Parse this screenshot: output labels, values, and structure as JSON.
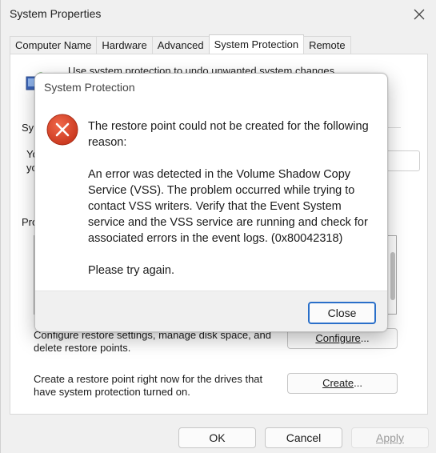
{
  "window": {
    "title": "System Properties"
  },
  "tabs": [
    {
      "label": "Computer Name"
    },
    {
      "label": "Hardware"
    },
    {
      "label": "Advanced"
    },
    {
      "label": "System Protection"
    },
    {
      "label": "Remote"
    }
  ],
  "panel": {
    "intro_partial": "Use system protection to undo unwanted system changes.",
    "sy_label": "Sy",
    "yo_line1": "Yo",
    "yo_line2": "yo",
    "pro_label": "Pro",
    "configure_text_line1": "Configure restore settings, manage disk space, and",
    "configure_text_line2": "delete restore points.",
    "configure_button_pre": "",
    "configure_button_u": "Configure",
    "configure_button_post": "...",
    "create_text_line1": "Create a restore point right now for the drives that",
    "create_text_line2": "have system protection turned on.",
    "create_button_pre": "",
    "create_button_u": "Create",
    "create_button_post": "..."
  },
  "buttons": {
    "ok": "OK",
    "cancel": "Cancel",
    "apply": "Apply"
  },
  "dialog": {
    "title": "System Protection",
    "icon": "error-icon",
    "message1": "The restore point could not be created for the following reason:",
    "message2": "An error was detected in the Volume Shadow Copy Service (VSS). The problem occurred while trying to contact VSS writers. Verify that the Event System service and the VSS service are running and check for associated errors in the event logs. (0x80042318)",
    "message3": "Please try again.",
    "close_label": "Close"
  },
  "colors": {
    "error_red": "#d9442a",
    "focus_blue": "#2a6fc9"
  }
}
